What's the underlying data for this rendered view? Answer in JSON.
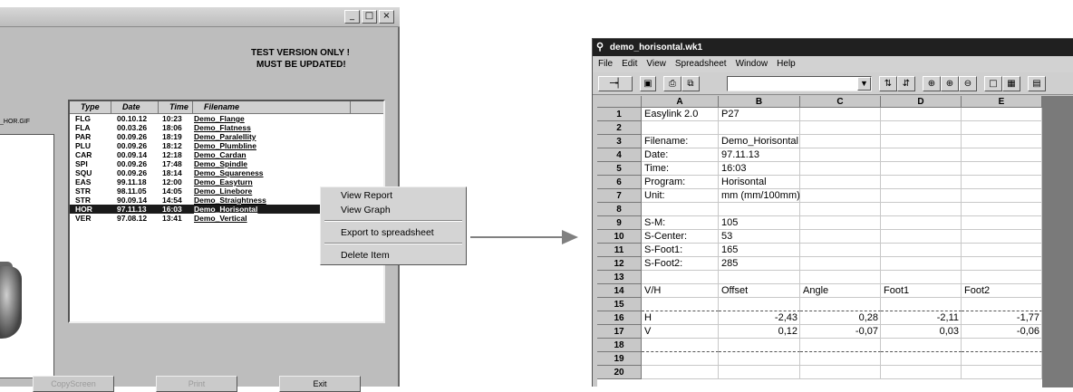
{
  "left_window": {
    "title_buttons": [
      "_",
      "□",
      "×"
    ],
    "notice_line1": "TEST VERSION ONLY !",
    "notice_line2": "MUST BE UPDATED!",
    "image_label": "_HOR.GIF",
    "list_headers": [
      "Type",
      "Date",
      "Time",
      "Filename"
    ],
    "rows": [
      {
        "type": "FLG",
        "date": "00.10.12",
        "time": "10:23",
        "filename": "Demo_Flange"
      },
      {
        "type": "FLA",
        "date": "00.03.26",
        "time": "18:06",
        "filename": "Demo_Flatness"
      },
      {
        "type": "PAR",
        "date": "00.09.26",
        "time": "18:19",
        "filename": "Demo_Paralellity"
      },
      {
        "type": "PLU",
        "date": "00.09.26",
        "time": "18:12",
        "filename": "Demo_Plumbline"
      },
      {
        "type": "CAR",
        "date": "00.09.14",
        "time": "12:18",
        "filename": "Demo_Cardan"
      },
      {
        "type": "SPI",
        "date": "00.09.26",
        "time": "17:48",
        "filename": "Demo_Spindle"
      },
      {
        "type": "SQU",
        "date": "00.09.26",
        "time": "18:14",
        "filename": "Demo_Squareness"
      },
      {
        "type": "EAS",
        "date": "99.11.18",
        "time": "12:00",
        "filename": "Demo_Easyturn"
      },
      {
        "type": "STR",
        "date": "98.11.05",
        "time": "14:05",
        "filename": "Demo_Linebore"
      },
      {
        "type": "STR",
        "date": "90.09.14",
        "time": "14:54",
        "filename": "Demo_Straightness"
      },
      {
        "type": "HOR",
        "date": "97.11.13",
        "time": "16:03",
        "filename": "Demo_Horisontal"
      },
      {
        "type": "VER",
        "date": "97.08.12",
        "time": "13:41",
        "filename": "Demo_Vertical"
      }
    ],
    "selected_row": 10,
    "context_menu": {
      "view_report": "View Report",
      "view_graph": "View Graph",
      "export": "Export to spreadsheet",
      "delete": "Delete Item"
    },
    "buttons": {
      "copy_screen": "CopyScreen",
      "print": "Print",
      "exit": "Exit"
    }
  },
  "sheet_window": {
    "title": "demo_horisontal.wk1",
    "menu": [
      "File",
      "Edit",
      "View",
      "Spreadsheet",
      "Window",
      "Help"
    ],
    "column_headers": [
      "A",
      "B",
      "C",
      "D",
      "E"
    ],
    "row_numbers": [
      "1",
      "2",
      "3",
      "4",
      "5",
      "6",
      "7",
      "8",
      "9",
      "10",
      "11",
      "12",
      "13",
      "14",
      "15",
      "16",
      "17",
      "18",
      "19",
      "20"
    ],
    "cells": {
      "r1": [
        "Easylink 2.0",
        "P27",
        "",
        "",
        ""
      ],
      "r3": [
        "Filename:",
        "Demo_Horisontal",
        "",
        "",
        ""
      ],
      "r4": [
        "Date:",
        "97.11.13",
        "",
        "",
        ""
      ],
      "r5": [
        "Time:",
        "16:03",
        "",
        "",
        ""
      ],
      "r6": [
        "Program:",
        "Horisontal",
        "",
        "",
        ""
      ],
      "r7": [
        "Unit:",
        "mm (mm/100mm)",
        "",
        "",
        ""
      ],
      "r9": [
        "S-M:",
        "105",
        "",
        "",
        ""
      ],
      "r10": [
        "S-Center:",
        "53",
        "",
        "",
        ""
      ],
      "r11": [
        "S-Foot1:",
        "165",
        "",
        "",
        ""
      ],
      "r12": [
        "S-Foot2:",
        "285",
        "",
        "",
        ""
      ],
      "r14": [
        "V/H",
        "Offset",
        "Angle",
        "Foot1",
        "Foot2"
      ],
      "r16": [
        "H",
        "-2,43",
        "0,28",
        "-2,11",
        "-1,77"
      ],
      "r17": [
        "V",
        "0,12",
        "-0,07",
        "0,03",
        "-0,06"
      ]
    }
  },
  "colors": {
    "window_gray": "#c4c4c4",
    "title_dark": "#202020",
    "selection": "#1a1a1a",
    "arrow": "#808080"
  }
}
